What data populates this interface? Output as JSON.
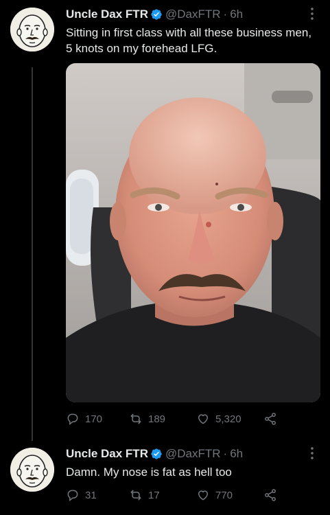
{
  "tweets": [
    {
      "display_name": "Uncle Dax FTR",
      "handle": "@DaxFTR",
      "separator": "·",
      "timestamp": "6h",
      "text": "Sitting in first class with all these business men, 5 knots on my forehead LFG.",
      "has_media": true,
      "reply_count": "170",
      "retweet_count": "189",
      "like_count": "5,320"
    },
    {
      "display_name": "Uncle Dax FTR",
      "handle": "@DaxFTR",
      "separator": "·",
      "timestamp": "6h",
      "text": "Damn. My nose is fat as hell too",
      "has_media": false,
      "reply_count": "31",
      "retweet_count": "17",
      "like_count": "770"
    }
  ],
  "icons": {
    "verified": "verified-badge-icon",
    "more": "more-options-icon",
    "reply": "reply-icon",
    "retweet": "retweet-icon",
    "like": "heart-icon",
    "share": "share-icon"
  },
  "colors": {
    "background": "#000000",
    "text_primary": "#e7e9ea",
    "text_secondary": "#71767b",
    "verified_blue": "#1d9bf0",
    "thread_line": "#333639"
  }
}
